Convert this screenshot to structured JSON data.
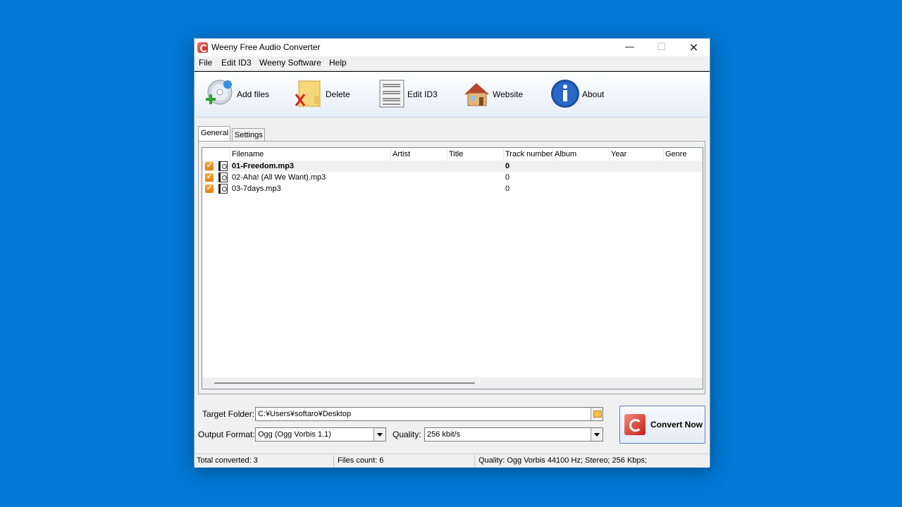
{
  "window": {
    "title": "Weeny Free Audio Converter"
  },
  "window_controls": {
    "minimize": "—",
    "maximize": "☐",
    "close": "✕"
  },
  "menu": [
    {
      "label": "File"
    },
    {
      "label": "Edit ID3"
    },
    {
      "label": "Weeny Software"
    },
    {
      "label": "Help"
    }
  ],
  "toolbar": {
    "add_files": "Add files",
    "delete": "Delete",
    "edit_id3": "Edit ID3",
    "website": "Website",
    "about": "About"
  },
  "tabs": {
    "general": "General",
    "settings": "Settings"
  },
  "columns": [
    "Filename",
    "Artist",
    "Title",
    "Track number",
    "Album",
    "Year",
    "Genre"
  ],
  "files": [
    {
      "filename": "01-Freedom.mp3",
      "artist": "",
      "title": "",
      "track": "0",
      "album": "",
      "year": "",
      "genre": "",
      "selected": true
    },
    {
      "filename": "02-Aha! (All We Want).mp3",
      "artist": "",
      "title": "",
      "track": "0",
      "album": "",
      "year": "",
      "genre": "",
      "selected": false
    },
    {
      "filename": "03-7days.mp3",
      "artist": "",
      "title": "",
      "track": "0",
      "album": "",
      "year": "",
      "genre": "",
      "selected": false
    }
  ],
  "target_folder": {
    "label": "Target Folder:",
    "value": "C:¥Users¥softaro¥Desktop"
  },
  "output_format": {
    "label": "Output Format:",
    "value": "Ogg (Ogg Vorbis 1.1)"
  },
  "quality": {
    "label": "Quality:",
    "value": "256 kbit/s"
  },
  "convert_button": {
    "label": "Convert Now"
  },
  "status": {
    "total_converted": "Total converted: 3",
    "files_count": "Files count: 6",
    "quality_info": "Quality: Ogg Vorbis 44100 Hz; Stereo; 256 Kbps;"
  },
  "colors": {
    "desktop": "#0078d4",
    "accent_orange": "#e27c10",
    "icon_red": "#c21f1a"
  }
}
